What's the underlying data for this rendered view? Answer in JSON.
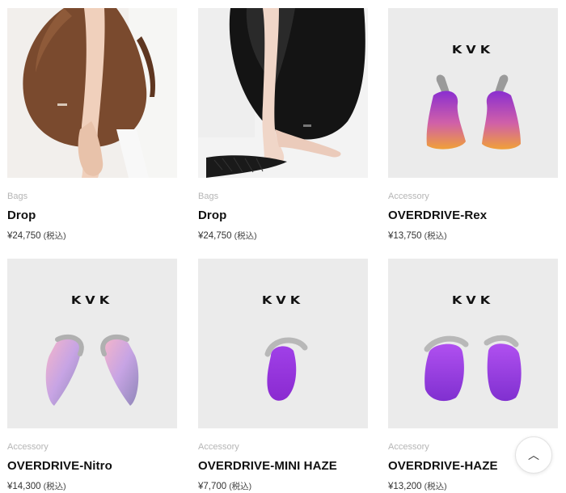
{
  "products": [
    {
      "category": "Bags",
      "name": "Drop",
      "price": "¥24,750",
      "tax": "(税込)",
      "image": "brown-bag-photo"
    },
    {
      "category": "Bags",
      "name": "Drop",
      "price": "¥24,750",
      "tax": "(税込)",
      "image": "black-bag-photo"
    },
    {
      "category": "Accessory",
      "name": "OVERDRIVE-Rex",
      "price": "¥13,750",
      "tax": "(税込)",
      "image": "rex-earrings-photo",
      "logo": "KVK"
    },
    {
      "category": "Accessory",
      "name": "OVERDRIVE-Nitro",
      "price": "¥14,300",
      "tax": "(税込)",
      "image": "nitro-earrings-photo",
      "logo": "KVK"
    },
    {
      "category": "Accessory",
      "name": "OVERDRIVE-MINI HAZE",
      "price": "¥7,700",
      "tax": "(税込)",
      "image": "mini-haze-earring-photo",
      "logo": "KVK"
    },
    {
      "category": "Accessory",
      "name": "OVERDRIVE-HAZE",
      "price": "¥13,200",
      "tax": "(税込)",
      "image": "haze-earrings-photo",
      "logo": "KVK"
    }
  ],
  "scroll_top": {
    "icon": "chevron-up-icon",
    "glyph": "︿"
  },
  "colors": {
    "category_text": "#b5b5b5",
    "photo_bg": "#ebebeb",
    "purple": "#9b3fe0",
    "orange": "#f0a030"
  }
}
